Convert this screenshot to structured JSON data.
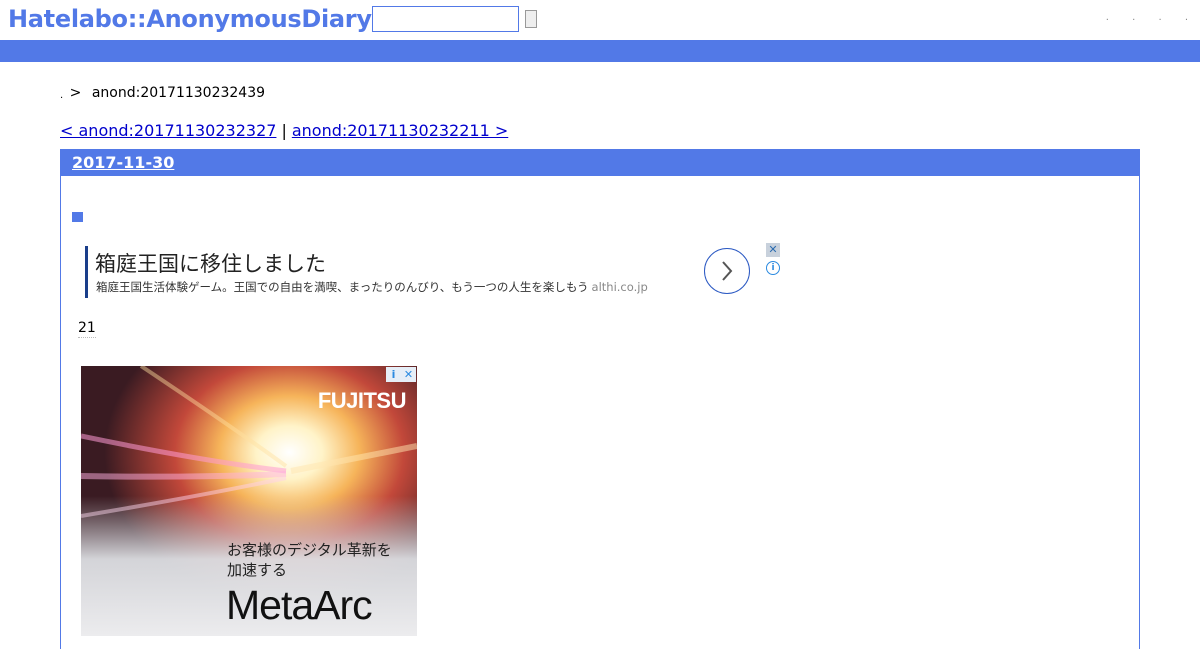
{
  "header": {
    "logo": "Hatelabo::AnonymousDiary",
    "search": {
      "value": "",
      "placeholder": ""
    },
    "links": [
      ".",
      ".",
      ".",
      "."
    ]
  },
  "breadcrumb": {
    "home": ".",
    "separator": ">",
    "current": "anond:20171130232439"
  },
  "pager": {
    "prev": "< anond:20171130232327",
    "separator": "|",
    "next": "anond:20171130232211 >"
  },
  "day": {
    "date": "2017-11-30",
    "section_mark": "■",
    "number": "21"
  },
  "text_ad": {
    "title": "箱庭王国に移住しました",
    "description": "箱庭王国生活体験ゲーム。王国での自由を満喫、まったりのんびり、もう一つの人生を楽しもう",
    "domain": "althi.co.jp"
  },
  "banner_ad": {
    "brand": "FUJITSU",
    "copy_line1": "お客様のデジタル革新を",
    "copy_line2": "加速する",
    "product": "MetaArc"
  },
  "colors": {
    "accent": "#5279e7",
    "link": "#0000cc",
    "ad_border": "#1a3e8a"
  }
}
